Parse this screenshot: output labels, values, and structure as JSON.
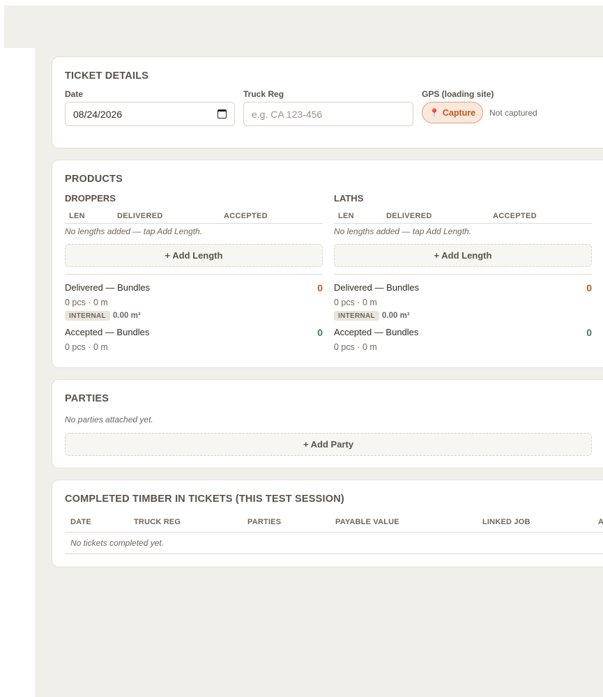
{
  "ticket_details": {
    "title": "TICKET DETAILS",
    "date_label": "Date",
    "date_value": "08/24/2026",
    "truck_label": "Truck Reg",
    "truck_placeholder": "e.g. CA 123-456",
    "gps_label": "GPS (loading site)",
    "capture_label": "Capture",
    "gps_status": "Not captured"
  },
  "products": {
    "title": "PRODUCTS",
    "columns": [
      "LEN",
      "DELIVERED",
      "ACCEPTED"
    ],
    "groups": [
      {
        "name": "DROPPERS",
        "empty_note": "No lengths added — tap Add Length.",
        "add_label": "+ Add Length",
        "delivered_label": "Delivered — Bundles",
        "delivered_value": "0",
        "delivered_meta": "0 pcs · 0 m",
        "internal_badge": "INTERNAL",
        "internal_volume": "0.00 m³",
        "accepted_label": "Accepted — Bundles",
        "accepted_value": "0",
        "accepted_meta": "0 pcs · 0 m"
      },
      {
        "name": "LATHS",
        "empty_note": "No lengths added — tap Add Length.",
        "add_label": "+ Add Length",
        "delivered_label": "Delivered — Bundles",
        "delivered_value": "0",
        "delivered_meta": "0 pcs · 0 m",
        "internal_badge": "INTERNAL",
        "internal_volume": "0.00 m³",
        "accepted_label": "Accepted — Bundles",
        "accepted_value": "0",
        "accepted_meta": "0 pcs · 0 m"
      }
    ]
  },
  "parties": {
    "title": "PARTIES",
    "empty_note": "No parties attached yet.",
    "add_label": "+ Add Party"
  },
  "completed": {
    "title": "COMPLETED TIMBER IN TICKETS (THIS TEST SESSION)",
    "columns": [
      "DATE",
      "TRUCK REG",
      "PARTIES",
      "PAYABLE VALUE",
      "LINKED JOB",
      "A"
    ],
    "empty_note": "No tickets completed yet."
  },
  "colors": {
    "accent": "#c2581d",
    "accepted": "#3d7b4f",
    "background": "#f1efea"
  }
}
